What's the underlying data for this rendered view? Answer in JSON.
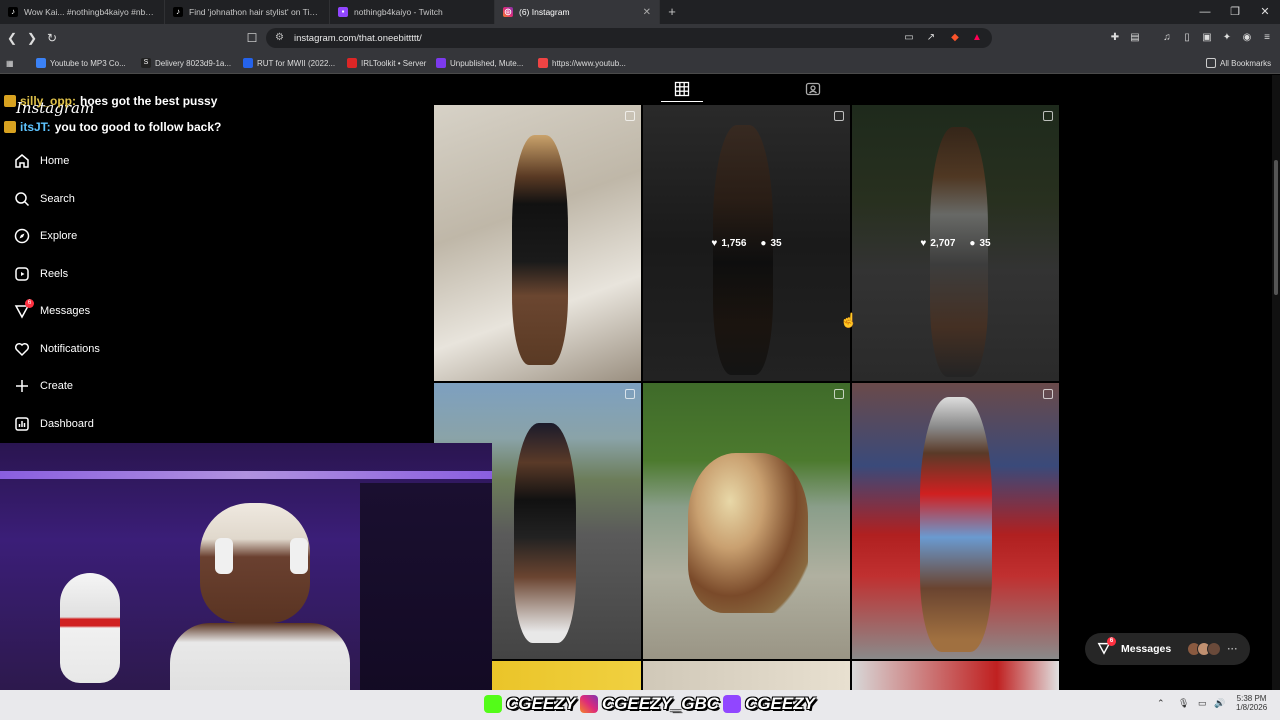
{
  "browser": {
    "tabs": [
      {
        "title": "Wow Kai... #nothingb4kaiyo #nb4 #",
        "icon": "tiktok-icon",
        "active": false
      },
      {
        "title": "Find 'johnathon hair stylist' on TikTok",
        "icon": "tiktok-icon",
        "active": false
      },
      {
        "title": "nothingb4kaiyo - Twitch",
        "icon": "twitch-icon",
        "active": false
      },
      {
        "title": "(6) Instagram",
        "icon": "instagram-icon",
        "active": true
      }
    ],
    "url": "instagram.com/that.oneebittttt/",
    "bookmarks": [
      {
        "label": "Youtube to MP3 Co...",
        "color": "#3b82f6"
      },
      {
        "label": "Delivery 8023d9-1a...",
        "color": "#222222"
      },
      {
        "label": "RUT for MWII (2022...",
        "color": "#2563eb"
      },
      {
        "label": "IRLToolkit • Server",
        "color": "#dc2626"
      },
      {
        "label": "Unpublished, Mute...",
        "color": "#7c3aed"
      },
      {
        "label": "https://www.youtub...",
        "color": "#ef4444"
      }
    ],
    "all_bookmarks": "All Bookmarks"
  },
  "chat": [
    {
      "user": "silly_opp:",
      "message": "hoes got the best pussy"
    },
    {
      "user": "itsJT:",
      "message": "you too good to follow back?"
    }
  ],
  "instagram": {
    "logo": "Instagram",
    "nav": [
      {
        "label": "Home",
        "icon": "home-icon"
      },
      {
        "label": "Search",
        "icon": "search-icon"
      },
      {
        "label": "Explore",
        "icon": "explore-icon"
      },
      {
        "label": "Reels",
        "icon": "reels-icon"
      },
      {
        "label": "Messages",
        "icon": "messages-icon",
        "badge": "6"
      },
      {
        "label": "Notifications",
        "icon": "heart-icon"
      },
      {
        "label": "Create",
        "icon": "plus-icon"
      },
      {
        "label": "Dashboard",
        "icon": "dashboard-icon"
      }
    ],
    "posts": [
      {
        "likes": "",
        "comments": ""
      },
      {
        "likes": "1,756",
        "comments": "35"
      },
      {
        "likes": "2,707",
        "comments": "35"
      },
      {
        "likes": "",
        "comments": ""
      },
      {
        "likes": "",
        "comments": ""
      },
      {
        "likes": "",
        "comments": ""
      }
    ],
    "messages_pill": {
      "label": "Messages",
      "badge": "6"
    }
  },
  "stream_overlay": {
    "handles": [
      "CGEEZY",
      "CGEEZY_GBC",
      "CGEEZY"
    ]
  },
  "taskbar": {
    "time": "5:38 PM",
    "date": "1/8/2026"
  },
  "colors": {
    "accent_badge": "#ff3040",
    "chat_user1": "#e0c24a",
    "chat_user2": "#5ec4ff"
  }
}
